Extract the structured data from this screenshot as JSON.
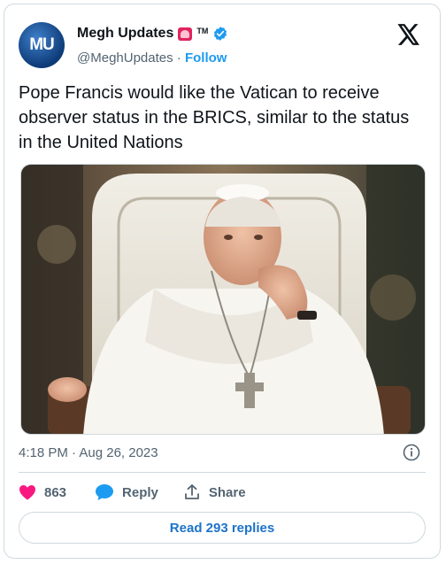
{
  "author": {
    "avatar_initials": "MU",
    "display_name": "Megh Updates",
    "badge_emoji_icon": "police-siren-icon",
    "tm_mark": "TM",
    "verified_icon": "verified-badge-icon",
    "handle": "@MeghUpdates",
    "separator": " · ",
    "follow_label": "Follow"
  },
  "platform_logo": "x-logo-icon",
  "tweet": {
    "text": "Pope Francis would like the Vatican to receive observer status in the BRICS, similar to the status in the United Nations",
    "timestamp": "4:18 PM · Aug 26, 2023"
  },
  "actions": {
    "like_count": "863",
    "reply_label": "Reply",
    "share_label": "Share"
  },
  "read_replies_label": "Read 293 replies",
  "colors": {
    "link": "#1d9bf0",
    "like": "#f91880",
    "muted": "#536471",
    "border": "#cfd9de"
  }
}
